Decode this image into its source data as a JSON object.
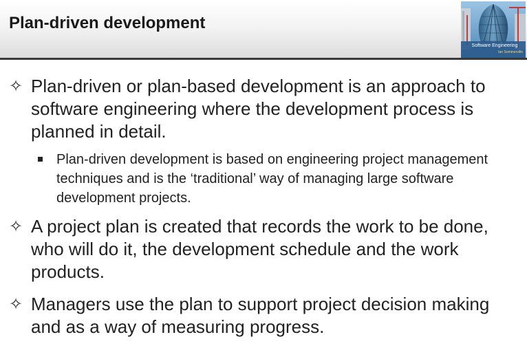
{
  "header": {
    "title": "Plan-driven development",
    "cover_title": "Software Engineering",
    "cover_author": "Ian Sommerville"
  },
  "bullets": [
    {
      "marker": "✧",
      "text": "Plan-driven or plan-based development is an approach to software engineering where the development process is planned in detail.",
      "sub": [
        {
          "text": "Plan-driven development is based on engineering project management  techniques and is the ‘traditional’ way of managing large software development projects."
        }
      ]
    },
    {
      "marker": "✧",
      "text": "A project plan is created that records the work to be done, who will do it, the development schedule and the work products."
    },
    {
      "marker": "✧",
      "text": "Managers use the plan to support project decision making and as a way of measuring progress."
    }
  ]
}
